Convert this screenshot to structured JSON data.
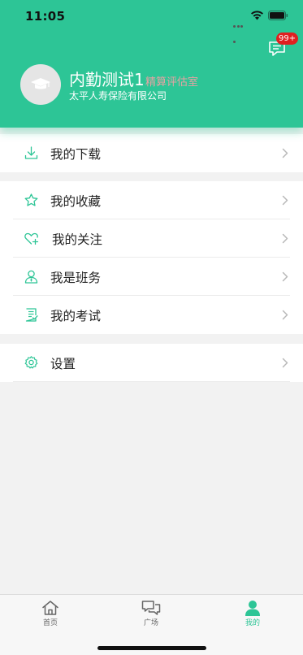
{
  "status_bar": {
    "time": "11:05"
  },
  "header": {
    "message_badge": "99+",
    "user_name": "内勤测试1",
    "department": "精算评估室",
    "company": "太平人寿保险有限公司"
  },
  "menu": {
    "group1": [
      {
        "label": "我的下载",
        "icon": "download-icon"
      }
    ],
    "group2": [
      {
        "label": "我的收藏",
        "icon": "star-icon"
      },
      {
        "label": "我的关注",
        "icon": "heart-plus-icon"
      },
      {
        "label": "我是班务",
        "icon": "person-icon"
      },
      {
        "label": "我的考试",
        "icon": "exam-list-icon"
      }
    ],
    "group3": [
      {
        "label": "设置",
        "icon": "gear-icon"
      }
    ]
  },
  "tabbar": {
    "tabs": [
      {
        "label": "首页",
        "icon": "home-icon",
        "active": false
      },
      {
        "label": "广场",
        "icon": "chat-bubbles-icon",
        "active": false
      },
      {
        "label": "我的",
        "icon": "profile-icon",
        "active": true
      }
    ]
  },
  "colors": {
    "accent": "#2dc596",
    "badge": "#e02020",
    "department_text": "#e6a3a3",
    "tab_inactive": "#666666"
  }
}
